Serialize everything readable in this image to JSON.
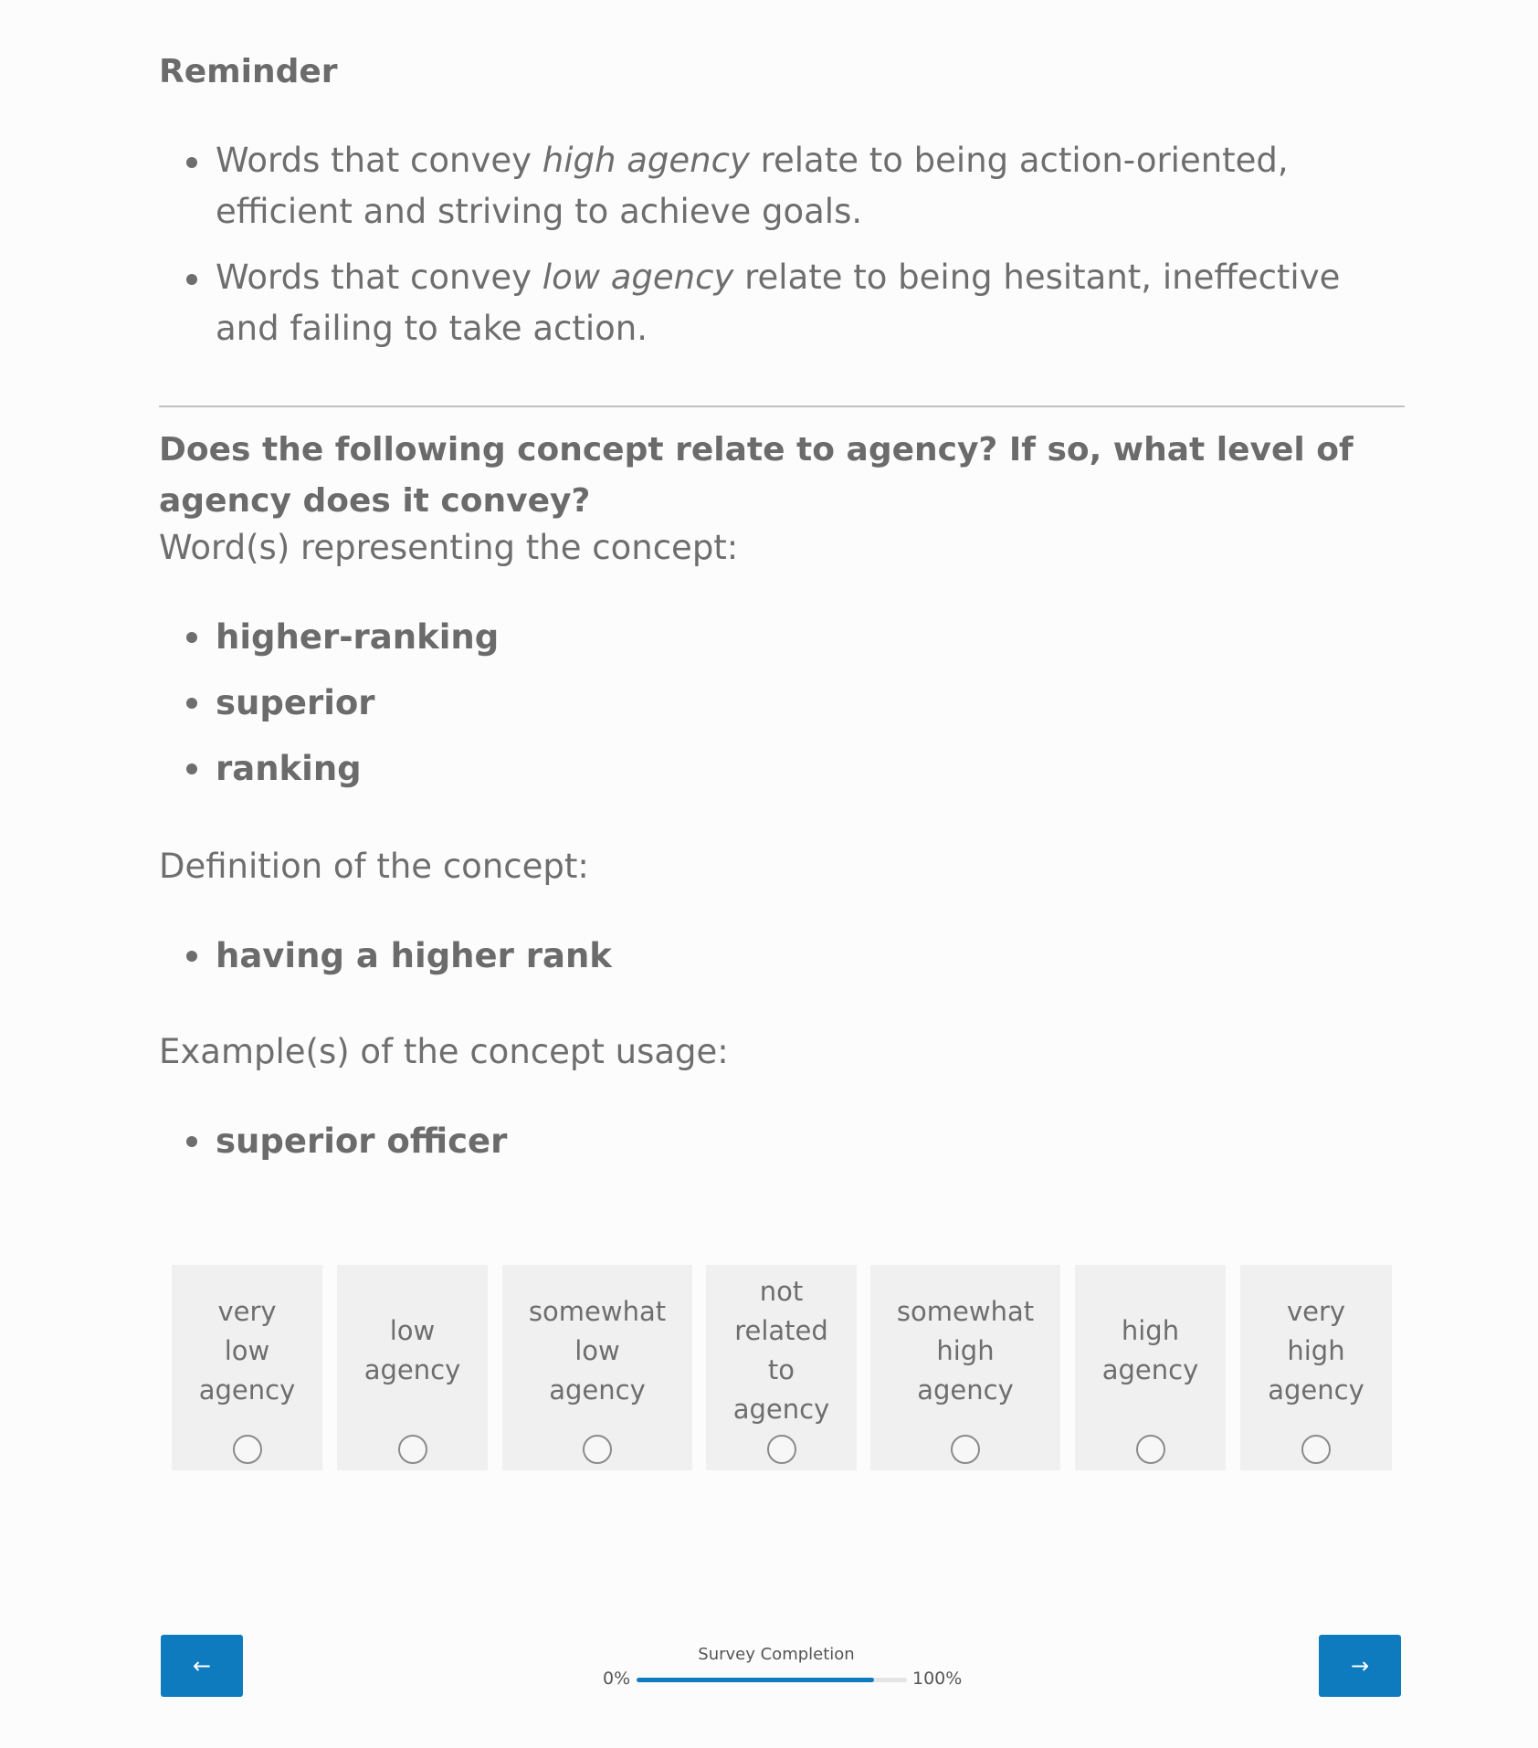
{
  "reminder": {
    "title": "Reminder",
    "items": [
      {
        "before": "Words that convey ",
        "emphasis": "high agency",
        "after": " relate to being action-oriented, efficient and striving to achieve goals."
      },
      {
        "before": "Words that convey ",
        "emphasis": "low agency",
        "after": " relate to being hesitant, ineffective and failing to take action."
      }
    ]
  },
  "question": {
    "text": "Does the following concept relate to agency? If so, what level of agency does it convey?",
    "words_label": "Word(s) representing the concept:",
    "words": [
      "higher-ranking",
      "superior",
      "ranking"
    ],
    "definition_label": "Definition of the concept:",
    "definitions": [
      "having a higher rank"
    ],
    "examples_label": "Example(s) of the concept usage:",
    "examples": [
      "superior officer"
    ]
  },
  "scale": {
    "options": [
      {
        "lines": [
          "very",
          "low",
          "agency"
        ]
      },
      {
        "lines": [
          "low",
          "agency"
        ]
      },
      {
        "lines": [
          "somewhat",
          "low",
          "agency"
        ]
      },
      {
        "lines": [
          "not",
          "related",
          "to",
          "agency"
        ]
      },
      {
        "lines": [
          "somewhat",
          "high",
          "agency"
        ]
      },
      {
        "lines": [
          "high",
          "agency"
        ]
      },
      {
        "lines": [
          "very",
          "high",
          "agency"
        ]
      }
    ]
  },
  "navigation": {
    "back_label": "←",
    "next_label": "→"
  },
  "progress": {
    "title": "Survey Completion",
    "min_label": "0%",
    "max_label": "100%",
    "fraction": 0.88
  }
}
